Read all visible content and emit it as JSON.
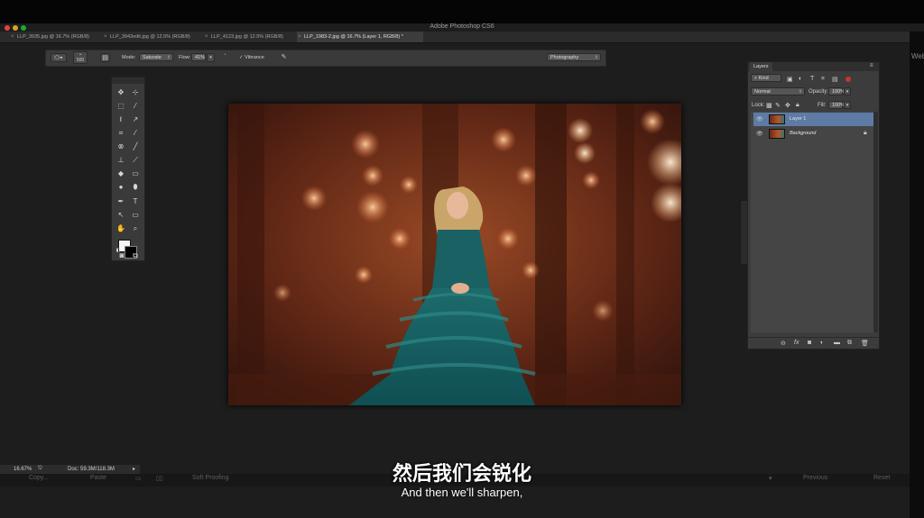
{
  "window": {
    "title": "Adobe Photoshop CS6"
  },
  "tabs": [
    {
      "label": "LLP_3935.jpg @ 16.7% (RGB/8)",
      "active": false
    },
    {
      "label": "LLP_3943edit.jpg @ 12.5% (RGB/8)",
      "active": false
    },
    {
      "label": "LLP_4123.jpg @ 12.5% (RGB/8)",
      "active": false
    },
    {
      "label": "LLP_1983-2.jpg @ 16.7% (Layer 1, RGB/8) *",
      "active": true
    }
  ],
  "options_bar": {
    "brush_size": "500",
    "mode_label": "Mode:",
    "mode_value": "Saturate",
    "flow_label": "Flow:",
    "flow_value": "41%",
    "vibrance_label": "Vibrance",
    "workspace_value": "Photography"
  },
  "tools": [
    "move-tool",
    "artboard-tool",
    "marquee-tool",
    "magic-wand-tool",
    "lasso-tool",
    "quick-select-tool",
    "crop-tool",
    "eyedropper-tool",
    "healing-brush-tool",
    "brush-tool",
    "clone-stamp-tool",
    "history-brush-tool",
    "eraser-tool",
    "gradient-tool",
    "blur-tool",
    "dodge-tool",
    "pen-tool",
    "type-tool",
    "path-select-tool",
    "shape-tool",
    "hand-tool",
    "zoom-tool"
  ],
  "layers_panel": {
    "tab_label": "Layers",
    "kind_label": "Kind",
    "blend_mode": "Normal",
    "opacity_label": "Opacity:",
    "opacity_value": "100%",
    "lock_label": "Lock:",
    "fill_label": "Fill:",
    "fill_value": "100%",
    "layers": [
      {
        "name": "Layer 1",
        "selected": true
      },
      {
        "name": "Background",
        "selected": false
      }
    ]
  },
  "status": {
    "zoom": "16.67%",
    "doc": "Doc: 59.3M/118.3M"
  },
  "bottom_bar": {
    "copy": "Copy...",
    "paste": "Paste",
    "soft_proofing": "Soft Proofing",
    "previous": "Previous",
    "reset": "Reset"
  },
  "right_edge_text": "Web",
  "subtitles": {
    "zh": "然后我们会锐化",
    "en": "And then we'll sharpen,"
  },
  "colors": {
    "selected_layer": "#5d7ba5",
    "panel_bg": "#3c3c3c",
    "workspace_bg": "#1d1d1d"
  }
}
